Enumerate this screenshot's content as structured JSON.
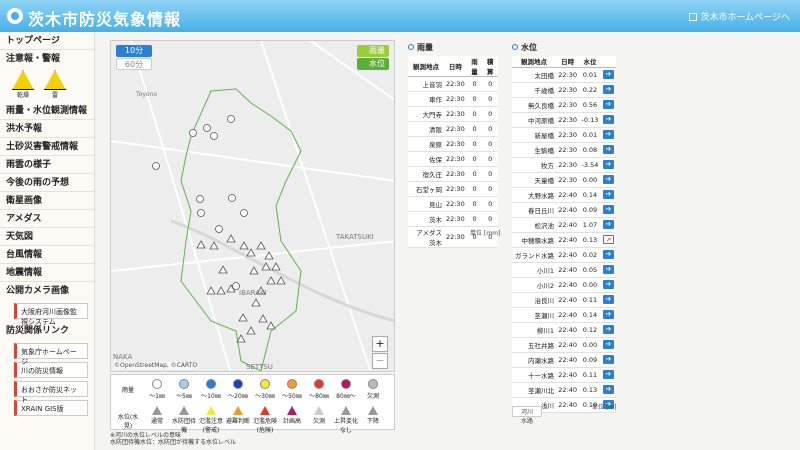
{
  "header": {
    "title": "茨木市防災気象情報",
    "home_link": "茨木市ホームページへ"
  },
  "sidebar": {
    "top": "トップページ",
    "warnings_title": "注意報・警報",
    "warning_icons": [
      "乾燥",
      "雷"
    ],
    "items": [
      "雨量・水位観測情報",
      "洪水予報",
      "土砂災害警戒情報",
      "雨雲の様子",
      "今後の雨の予想",
      "衛星画像",
      "アメダス",
      "天気図",
      "台風情報",
      "地震情報",
      "公開カメラ画像"
    ],
    "camera_sub": "大阪府河川画像監視システム",
    "links_title": "防災関係リンク",
    "links": [
      "気象庁ホームページ",
      "川の防災情報",
      "おおさか防災ネット",
      "XRAIN GIS版"
    ]
  },
  "map": {
    "btn_10": "10分",
    "btn_60": "60分",
    "layer_rain": "雨量",
    "layer_water": "水位",
    "zoom_in": "+",
    "zoom_out": "−",
    "attribution": "©OpenStreetMap, ©CARTO",
    "places": [
      "Toyono",
      "TAKATSUKI",
      "IBARAKI",
      "SETTSU",
      "NAKA"
    ]
  },
  "legend": {
    "rain_label": "雨量",
    "rain_items": [
      "〜1㎜",
      "〜5㎜",
      "〜10㎜",
      "〜20㎜",
      "〜30㎜",
      "〜50㎜",
      "〜80㎜",
      "80㎜〜",
      "欠測"
    ],
    "rain_colors": [
      "#ffffff",
      "#a0cfef",
      "#2b7fd4",
      "#1a3fc4",
      "#f4e83a",
      "#f29a2a",
      "#e23a2a",
      "#b0186a",
      "#bbbbbb"
    ],
    "water_label": "水位(水晃)",
    "water_items": [
      "通常",
      "水防団待機",
      "氾濫注意(警戒)",
      "避難判断",
      "氾濫危険(危険)",
      "計画高",
      "欠測",
      "上昇変化なし",
      "下降"
    ]
  },
  "notes": [
    "※河川の水位レベルの意味",
    "水防団待機水位：水防団が待機する水位レベル"
  ],
  "rain": {
    "title": "雨量",
    "headers": [
      "観測地点",
      "日時",
      "雨量",
      "積算"
    ],
    "rows": [
      [
        "上音羽",
        "22:30",
        "0",
        "0"
      ],
      [
        "車作",
        "22:30",
        "0",
        "0"
      ],
      [
        "大門寺",
        "22:30",
        "0",
        "0"
      ],
      [
        "清阪",
        "22:30",
        "0",
        "0"
      ],
      [
        "泉原",
        "22:30",
        "0",
        "0"
      ],
      [
        "佐保",
        "22:30",
        "0",
        "0"
      ],
      [
        "宿久庄",
        "22:30",
        "0",
        "0"
      ],
      [
        "石堂ヶ岡",
        "22:30",
        "0",
        "0"
      ],
      [
        "見山",
        "22:30",
        "0",
        "0"
      ],
      [
        "茨木",
        "22:30",
        "0",
        "0"
      ],
      [
        "アメダス茨木",
        "22:30",
        "0",
        "0"
      ]
    ],
    "unit": "単位 [mm]"
  },
  "water": {
    "title": "水位",
    "headers": [
      "観測地点",
      "日時",
      "水位"
    ],
    "rows": [
      [
        "太田橋",
        "22:30",
        "0.01"
      ],
      [
        "千歳橋",
        "22:30",
        "0.22"
      ],
      [
        "無久良橋",
        "22:30",
        "0.56"
      ],
      [
        "中河原橋",
        "22:30",
        "-0.13"
      ],
      [
        "新屋橋",
        "22:30",
        "0.01"
      ],
      [
        "生駒橋",
        "22:30",
        "0.08"
      ],
      [
        "牧方",
        "22:30",
        "-3.54"
      ],
      [
        "天童橋",
        "22:30",
        "0.00"
      ],
      [
        "大野水路",
        "22:40",
        "0.14"
      ],
      [
        "春日丘川",
        "22:40",
        "0.09"
      ],
      [
        "松沢池",
        "22:40",
        "1.07"
      ],
      [
        "中穂積水路",
        "22:40",
        "0.13"
      ],
      [
        "ガランド水路",
        "22:40",
        "0.02"
      ],
      [
        "小川1",
        "22:40",
        "0.05"
      ],
      [
        "小川2",
        "22:40",
        "0.00"
      ],
      [
        "治良川",
        "22:40",
        "0.11"
      ],
      [
        "茎瀬川",
        "22:40",
        "0.14"
      ],
      [
        "柳川1",
        "22:40",
        "0.12"
      ],
      [
        "五社井路",
        "22:40",
        "0.00"
      ],
      [
        "内瀬水路",
        "22:40",
        "0.09"
      ],
      [
        "十一水路",
        "22:40",
        "0.11"
      ],
      [
        "茎瀬川北",
        "22:40",
        "0.13"
      ],
      [
        "浅川",
        "22:40",
        "0.10"
      ]
    ],
    "unit": "単位 [m]",
    "legend_a": "河川",
    "legend_b": "水路"
  }
}
